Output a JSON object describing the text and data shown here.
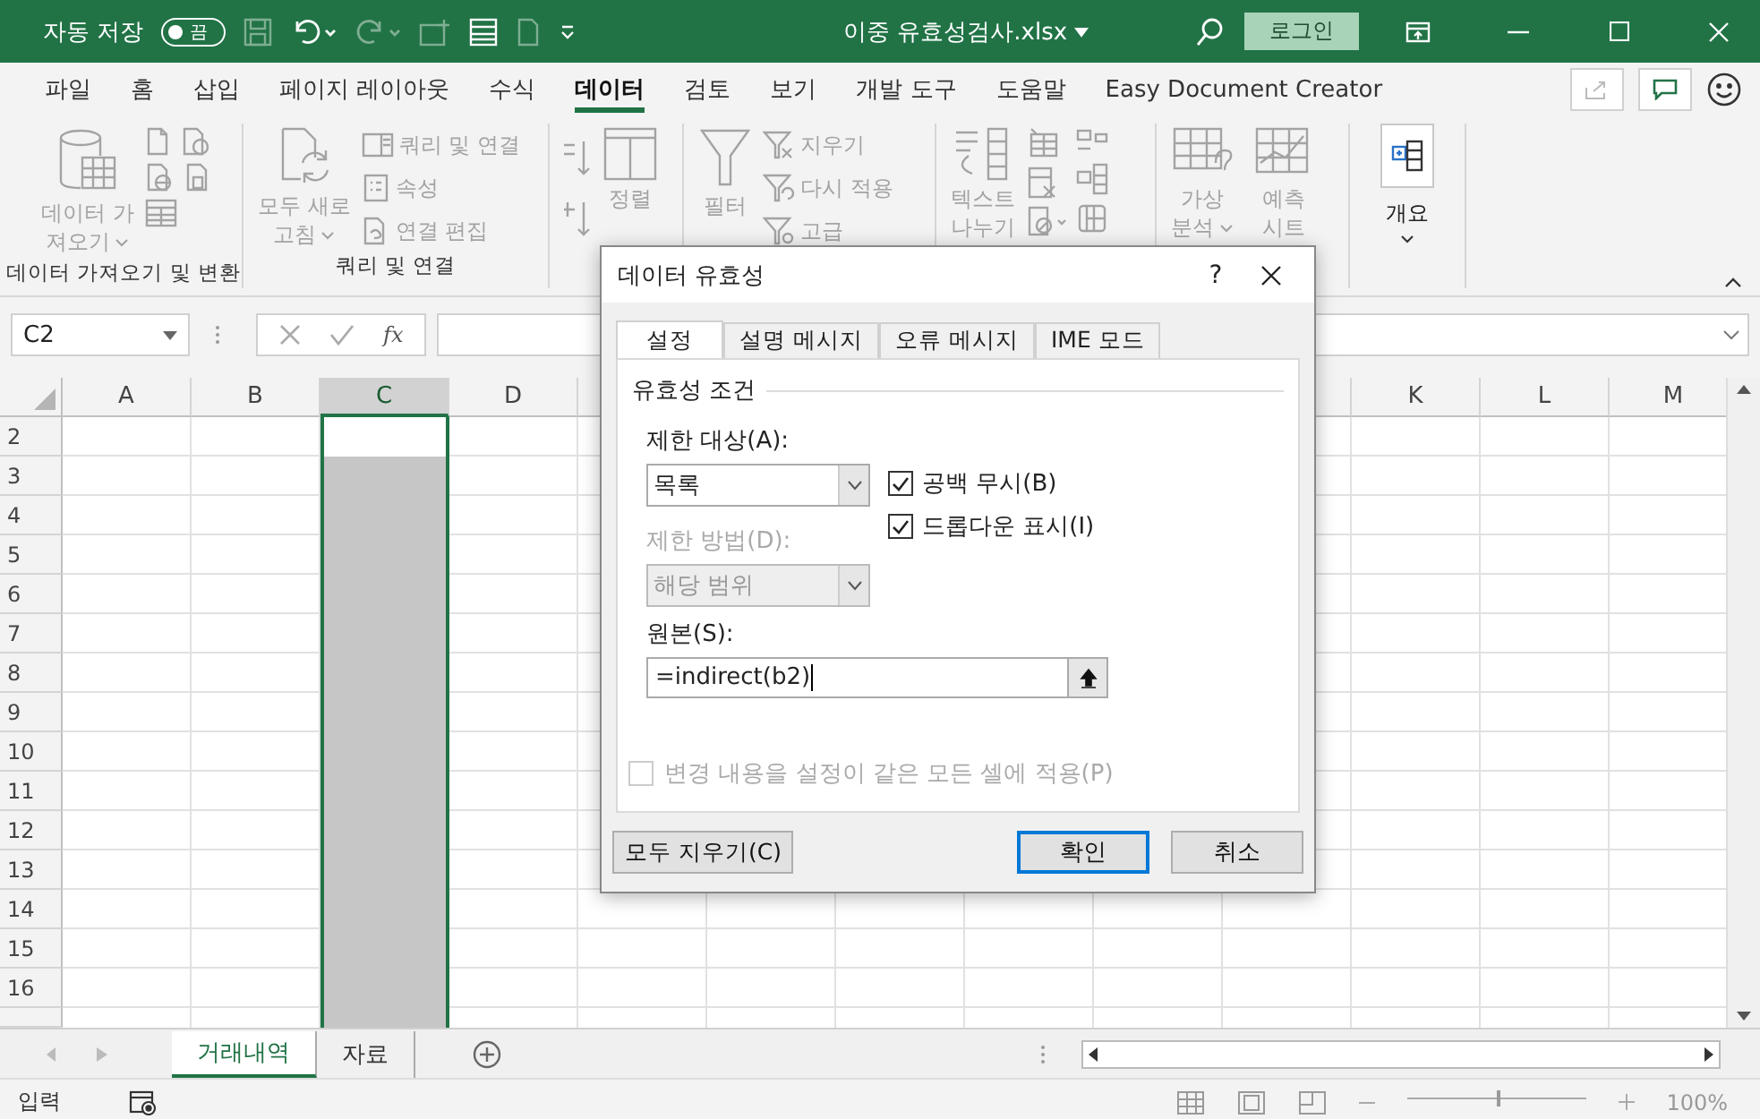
{
  "title_bar": {
    "autosave_label": "자동 저장",
    "autosave_toggle": {
      "label": "끔",
      "on": false
    },
    "document_title": "이중 유효성검사.xlsx",
    "login_button": "로그인"
  },
  "menu_tabs": [
    {
      "label": "파일",
      "selected": false
    },
    {
      "label": "홈",
      "selected": false
    },
    {
      "label": "삽입",
      "selected": false
    },
    {
      "label": "페이지 레이아웃",
      "selected": false
    },
    {
      "label": "수식",
      "selected": false
    },
    {
      "label": "데이터",
      "selected": true
    },
    {
      "label": "검토",
      "selected": false
    },
    {
      "label": "보기",
      "selected": false
    },
    {
      "label": "개발 도구",
      "selected": false
    },
    {
      "label": "도움말",
      "selected": false
    },
    {
      "label": "Easy Document Creator",
      "selected": false
    }
  ],
  "ribbon": {
    "get_data": {
      "button": "데이터 가\n져오기",
      "group_label": "데이터 가져오기 및 변환"
    },
    "queries": {
      "refresh_button": "모두 새로\n고침",
      "queries_connections": "쿼리 및 연결",
      "properties": "속성",
      "edit_links": "연결 편집",
      "group_label": "쿼리 및 연결"
    },
    "sort_filter": {
      "sort": "정렬",
      "filter": "필터",
      "clear": "지우기",
      "reapply": "다시 적용",
      "advanced": "고급"
    },
    "data_tools": {
      "text_to_columns": "텍스트\n나누기"
    },
    "forecast": {
      "what_if": "가상\n분석",
      "forecast_sheet": "예측\n시트"
    },
    "outline": {
      "button": "개요"
    }
  },
  "formula_bar": {
    "name_box": "C2",
    "function_label": "fx"
  },
  "column_headers_left": [
    {
      "label": "A",
      "selected": false
    },
    {
      "label": "B",
      "selected": false
    },
    {
      "label": "C",
      "selected": true
    },
    {
      "label": "D",
      "selected": false
    }
  ],
  "column_headers_right": [
    {
      "label": "K",
      "selected": false
    },
    {
      "label": "L",
      "selected": false
    },
    {
      "label": "M",
      "selected": false
    }
  ],
  "rows": [
    {
      "label": "2",
      "active": true
    },
    {
      "label": "3",
      "active": false
    },
    {
      "label": "4",
      "active": false
    },
    {
      "label": "5",
      "active": false
    },
    {
      "label": "6",
      "active": false
    },
    {
      "label": "7",
      "active": false
    },
    {
      "label": "8",
      "active": false
    },
    {
      "label": "9",
      "active": false
    },
    {
      "label": "10",
      "active": false
    },
    {
      "label": "11",
      "active": false
    },
    {
      "label": "12",
      "active": false
    },
    {
      "label": "13",
      "active": false
    },
    {
      "label": "14",
      "active": false
    },
    {
      "label": "15",
      "active": false
    },
    {
      "label": "16",
      "active": false
    }
  ],
  "sheet_tabs": [
    {
      "label": "거래내역",
      "selected": true
    },
    {
      "label": "자료",
      "selected": false
    }
  ],
  "status_bar": {
    "mode": "입력",
    "zoom_slider": {
      "level": 0.5
    },
    "zoom": "100%"
  },
  "dialog": {
    "title": "데이터 유효성",
    "help": "?",
    "tabs": [
      {
        "label": "설정",
        "selected": true
      },
      {
        "label": "설명 메시지",
        "selected": false
      },
      {
        "label": "오류 메시지",
        "selected": false
      },
      {
        "label": "IME 모드",
        "selected": false
      }
    ],
    "section_title": "유효성 조건",
    "allow_label": "제한 대상(A):",
    "allow_value": "목록",
    "data_label": "제한 방법(D):",
    "data_value": "해당 범위",
    "data_disabled": true,
    "checkboxes": [
      {
        "label": "공백 무시(B)",
        "checked": true
      },
      {
        "label": "드롭다운 표시(I)",
        "checked": true
      }
    ],
    "source_label": "원본(S):",
    "source_value": "=indirect(b2)",
    "apply_all": {
      "label": "변경 내용을 설정이 같은 모든 셀에 적용(P)",
      "checked": false,
      "disabled": true
    },
    "buttons": [
      {
        "label": "모두 지우기(C)",
        "kind": "clear"
      },
      {
        "label": "확인",
        "kind": "default"
      },
      {
        "label": "취소",
        "kind": "cancel"
      }
    ]
  }
}
